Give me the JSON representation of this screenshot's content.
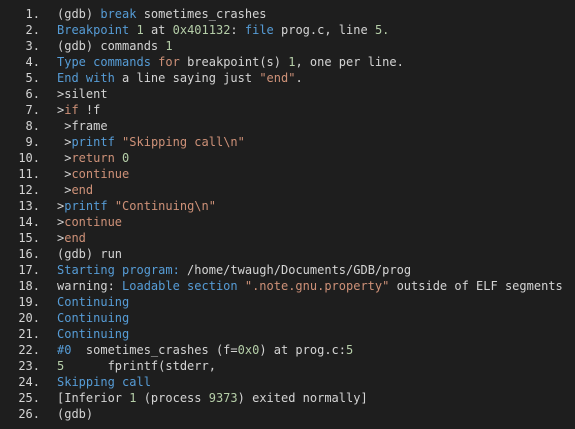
{
  "colors": {
    "background": "#1e1e1e",
    "default": "#d4d4d4",
    "keyword": "#569cd6",
    "number": "#b5cea8",
    "string": "#ce9178",
    "prompt": "#d4d4d4"
  },
  "lines": [
    {
      "num": "1.",
      "tokens": [
        {
          "t": "(gdb) ",
          "c": "d"
        },
        {
          "t": "break",
          "c": "k"
        },
        {
          "t": " sometimes_crashes",
          "c": "d"
        }
      ]
    },
    {
      "num": "2.",
      "tokens": [
        {
          "t": "Breakpoint ",
          "c": "k"
        },
        {
          "t": "1",
          "c": "n"
        },
        {
          "t": " at ",
          "c": "d"
        },
        {
          "t": "0x401132",
          "c": "n"
        },
        {
          "t": ": ",
          "c": "d"
        },
        {
          "t": "file",
          "c": "k"
        },
        {
          "t": " prog.c, line ",
          "c": "d"
        },
        {
          "t": "5.",
          "c": "n"
        }
      ]
    },
    {
      "num": "3.",
      "tokens": [
        {
          "t": "(gdb) ",
          "c": "d"
        },
        {
          "t": "commands",
          "c": "d"
        },
        {
          "t": " 1",
          "c": "n"
        }
      ]
    },
    {
      "num": "4.",
      "tokens": [
        {
          "t": "Type commands ",
          "c": "k"
        },
        {
          "t": "for",
          "c": "s"
        },
        {
          "t": " breakpoint(s) ",
          "c": "d"
        },
        {
          "t": "1",
          "c": "n"
        },
        {
          "t": ", one per line.",
          "c": "d"
        }
      ]
    },
    {
      "num": "5.",
      "tokens": [
        {
          "t": "End ",
          "c": "k"
        },
        {
          "t": "with",
          "c": "k"
        },
        {
          "t": " a line saying just ",
          "c": "d"
        },
        {
          "t": "\"end\"",
          "c": "s"
        },
        {
          "t": ".",
          "c": "d"
        }
      ]
    },
    {
      "num": "6.",
      "tokens": [
        {
          "t": ">silent",
          "c": "d"
        }
      ]
    },
    {
      "num": "7.",
      "tokens": [
        {
          "t": ">",
          "c": "d"
        },
        {
          "t": "if",
          "c": "s"
        },
        {
          "t": " !f",
          "c": "d"
        }
      ]
    },
    {
      "num": "8.",
      "tokens": [
        {
          "t": " >frame",
          "c": "d"
        }
      ]
    },
    {
      "num": "9.",
      "tokens": [
        {
          "t": " >",
          "c": "d"
        },
        {
          "t": "printf",
          "c": "k"
        },
        {
          "t": " ",
          "c": "d"
        },
        {
          "t": "\"Skipping call\\n\"",
          "c": "s"
        }
      ]
    },
    {
      "num": "10.",
      "tokens": [
        {
          "t": " >",
          "c": "d"
        },
        {
          "t": "return",
          "c": "s"
        },
        {
          "t": " ",
          "c": "d"
        },
        {
          "t": "0",
          "c": "n"
        }
      ]
    },
    {
      "num": "11.",
      "tokens": [
        {
          "t": " >",
          "c": "d"
        },
        {
          "t": "continue",
          "c": "s"
        }
      ]
    },
    {
      "num": "12.",
      "tokens": [
        {
          "t": " >",
          "c": "d"
        },
        {
          "t": "end",
          "c": "s"
        }
      ]
    },
    {
      "num": "13.",
      "tokens": [
        {
          "t": ">",
          "c": "d"
        },
        {
          "t": "printf",
          "c": "k"
        },
        {
          "t": " ",
          "c": "d"
        },
        {
          "t": "\"Continuing\\n\"",
          "c": "s"
        }
      ]
    },
    {
      "num": "14.",
      "tokens": [
        {
          "t": ">",
          "c": "d"
        },
        {
          "t": "continue",
          "c": "s"
        }
      ]
    },
    {
      "num": "15.",
      "tokens": [
        {
          "t": ">",
          "c": "d"
        },
        {
          "t": "end",
          "c": "s"
        }
      ]
    },
    {
      "num": "16.",
      "tokens": [
        {
          "t": "(gdb) ",
          "c": "d"
        },
        {
          "t": "run",
          "c": "d"
        }
      ]
    },
    {
      "num": "17.",
      "tokens": [
        {
          "t": "Starting program: ",
          "c": "k"
        },
        {
          "t": "/home/",
          "c": "d"
        },
        {
          "t": "twaugh",
          "c": "d"
        },
        {
          "t": "/",
          "c": "d"
        },
        {
          "t": "Documents",
          "c": "d"
        },
        {
          "t": "/GDB/prog",
          "c": "d"
        }
      ]
    },
    {
      "num": "18.",
      "tokens": [
        {
          "t": "warning: ",
          "c": "d"
        },
        {
          "t": "Loadable section ",
          "c": "k"
        },
        {
          "t": "\".note.gnu.property\"",
          "c": "s"
        },
        {
          "t": " outside of ELF segments",
          "c": "d"
        }
      ]
    },
    {
      "num": "19.",
      "tokens": [
        {
          "t": "Continuing",
          "c": "k"
        }
      ]
    },
    {
      "num": "20.",
      "tokens": [
        {
          "t": "Continuing",
          "c": "k"
        }
      ]
    },
    {
      "num": "21.",
      "tokens": [
        {
          "t": "Continuing",
          "c": "k"
        }
      ]
    },
    {
      "num": "22.",
      "tokens": [
        {
          "t": "#0",
          "c": "k"
        },
        {
          "t": "  sometimes_crashes (f=",
          "c": "d"
        },
        {
          "t": "0x0",
          "c": "n"
        },
        {
          "t": ") at prog.c:",
          "c": "d"
        },
        {
          "t": "5",
          "c": "n"
        }
      ]
    },
    {
      "num": "23.",
      "tokens": [
        {
          "t": "5",
          "c": "n"
        },
        {
          "t": "      fprintf(stderr,",
          "c": "d"
        }
      ]
    },
    {
      "num": "24.",
      "tokens": [
        {
          "t": "Skipping call",
          "c": "k"
        }
      ]
    },
    {
      "num": "25.",
      "tokens": [
        {
          "t": "[Inferior ",
          "c": "d"
        },
        {
          "t": "1",
          "c": "n"
        },
        {
          "t": " (process ",
          "c": "d"
        },
        {
          "t": "9373",
          "c": "n"
        },
        {
          "t": ") exited normally]",
          "c": "d"
        }
      ]
    },
    {
      "num": "26.",
      "tokens": [
        {
          "t": "(gdb)",
          "c": "d"
        }
      ]
    }
  ]
}
